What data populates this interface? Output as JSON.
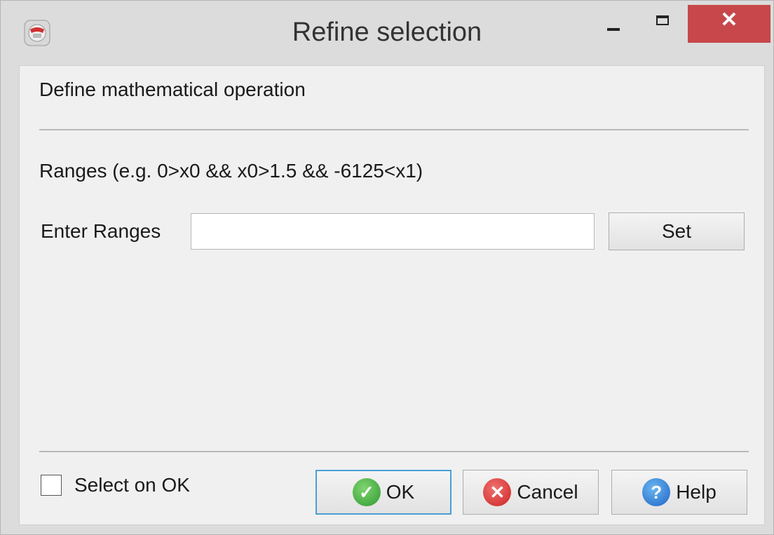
{
  "window": {
    "title": "Refine selection",
    "icon": "app-icon",
    "controls": {
      "minimize_icon": "minimize-icon",
      "maximize_icon": "maximize-icon",
      "close_glyph": "✕"
    }
  },
  "main": {
    "heading": "Define mathematical operation",
    "ranges_hint": "Ranges (e.g. 0>x0 && x0>1.5 && -6125<x1)",
    "ranges_label": "Enter Ranges",
    "ranges_value": "",
    "set_label": "Set"
  },
  "footer": {
    "select_on_ok_label": "Select on OK",
    "select_on_ok_checked": false,
    "ok_label": "OK",
    "cancel_label": "Cancel",
    "help_label": "Help",
    "ok_icon_glyph": "✓",
    "cancel_icon_glyph": "✕",
    "help_icon_glyph": "?"
  },
  "colors": {
    "close_button": "#c8474a",
    "ok_focus_border": "#4a9fd8",
    "ok_icon": "#2e9a33",
    "cancel_icon": "#cc2424",
    "help_icon": "#1f64c8"
  }
}
